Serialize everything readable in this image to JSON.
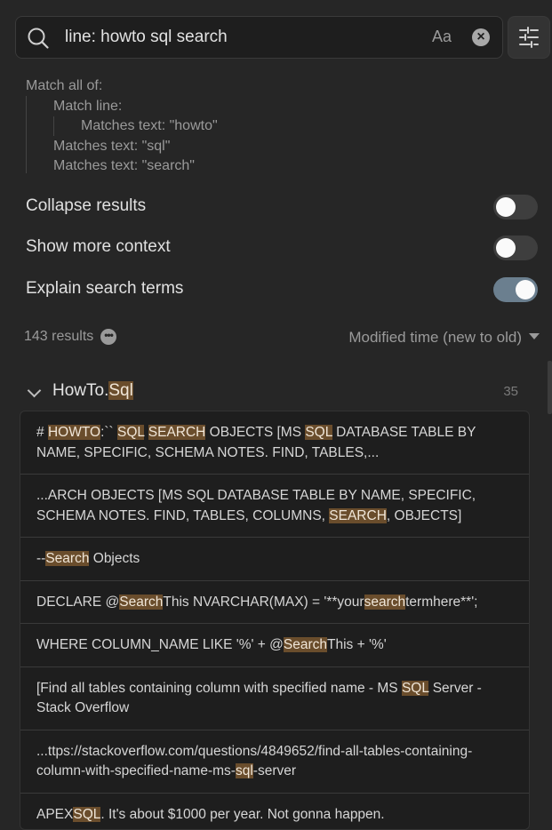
{
  "search": {
    "query": "line: howto sql search",
    "match_case_label": "Aa",
    "clear_label": "×"
  },
  "explain": {
    "line1": "Match all of:",
    "line2": "Match line:",
    "line3": "Matches text: \"howto\"",
    "line4": "Matches text: \"sql\"",
    "line5": "Matches text: \"search\""
  },
  "toggles": [
    {
      "label": "Collapse results",
      "on": false
    },
    {
      "label": "Show more context",
      "on": false
    },
    {
      "label": "Explain search terms",
      "on": true
    }
  ],
  "results_meta": {
    "count": "143 results",
    "more_label": "•••",
    "sort": "Modified time (new to old)"
  },
  "file": {
    "name_pre": "HowTo.",
    "name_hl": "Sql",
    "count": "35"
  },
  "results": [
    [
      {
        "t": "# "
      },
      {
        "t": "HOWTO",
        "h": true
      },
      {
        "t": ":`` "
      },
      {
        "t": "SQL",
        "h": true
      },
      {
        "t": " "
      },
      {
        "t": "SEARCH",
        "h": true
      },
      {
        "t": " OBJECTS         [MS "
      },
      {
        "t": "SQL",
        "h": true
      },
      {
        "t": " DATABASE TABLE BY NAME, SPECIFIC, SCHEMA NOTES. FIND, TABLES,..."
      }
    ],
    [
      {
        "t": "...ARCH OBJECTS         [MS SQL DATABASE TABLE BY NAME, SPECIFIC, SCHEMA NOTES. FIND, TABLES, COLUMNS, "
      },
      {
        "t": "SEARCH",
        "h": true
      },
      {
        "t": ", OBJECTS]"
      }
    ],
    [
      {
        "t": "--"
      },
      {
        "t": "Search",
        "h": true
      },
      {
        "t": " Objects"
      }
    ],
    [
      {
        "t": "DECLARE @"
      },
      {
        "t": "Search",
        "h": true
      },
      {
        "t": "This NVARCHAR(MAX) = '**your"
      },
      {
        "t": "search",
        "h": true
      },
      {
        "t": "termhere**';"
      }
    ],
    [
      {
        "t": "WHERE COLUMN_NAME LIKE '%' + @"
      },
      {
        "t": "Search",
        "h": true
      },
      {
        "t": "This + '%'"
      }
    ],
    [
      {
        "t": "[Find all tables containing column with specified name - MS "
      },
      {
        "t": "SQL",
        "h": true
      },
      {
        "t": " Server - Stack Overflow"
      }
    ],
    [
      {
        "t": "...ttps://stackoverflow.com/questions/4849652/find-all-tables-containing-column-with-specified-name-ms-"
      },
      {
        "t": "sql",
        "h": true
      },
      {
        "t": "-server"
      }
    ],
    [
      {
        "t": "APEX"
      },
      {
        "t": "SQL",
        "h": true
      },
      {
        "t": ". It's about $1000 per year. Not gonna happen."
      }
    ]
  ]
}
